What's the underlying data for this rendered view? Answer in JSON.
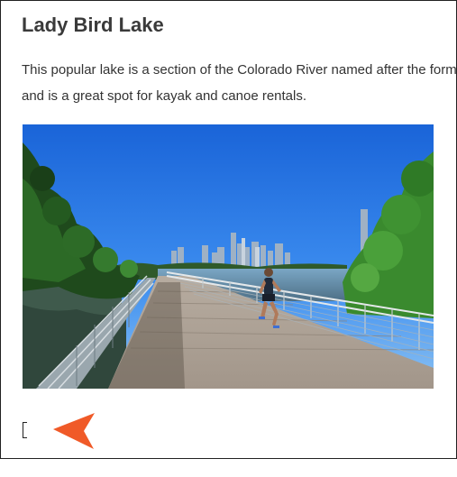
{
  "article": {
    "title": "Lady Bird Lake",
    "description": "This popular lake is a section of the Colorado River named after the former first lady and is a great spot for kayak and canoe rentals."
  },
  "image": {
    "subject": "lake-boardwalk-photo"
  },
  "colors": {
    "title": "#3a3a3a",
    "text": "#333333",
    "pointer": "#f05a28",
    "frame_border": "#222222"
  },
  "icons": {
    "pointer": "arrow-pointer-icon",
    "caret": "text-caret-icon"
  }
}
